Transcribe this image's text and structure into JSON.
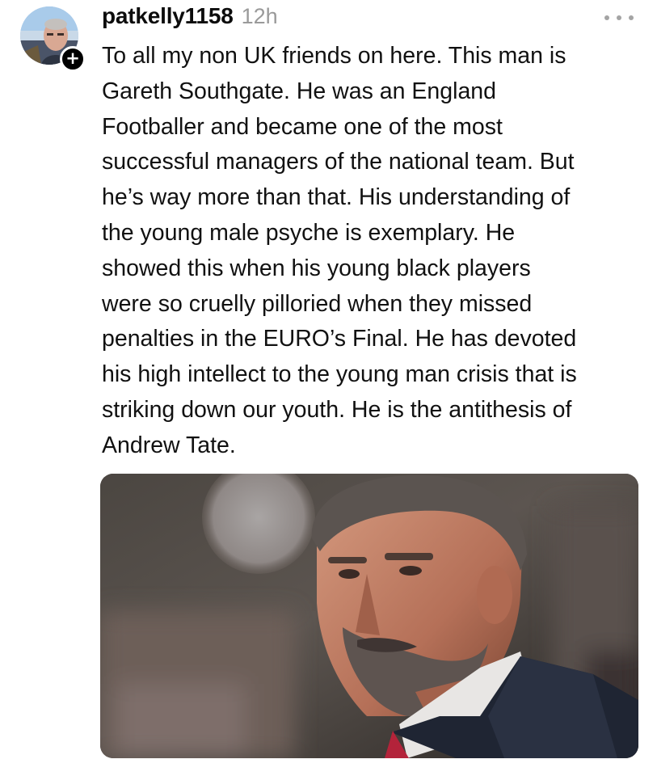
{
  "post": {
    "author": {
      "username": "patkelly1158",
      "avatar_icon": "profile-photo",
      "follow_icon": "plus-icon",
      "follow_symbol": "+"
    },
    "timestamp": "12h",
    "more_icon": "more-horizontal-icon",
    "text_lines": [
      "To all my non UK friends on here. This man is",
      "Gareth Southgate. He was an England",
      "Footballer and became one of the most",
      "successful managers of the national team. But",
      "he’s way more than that. His understanding of",
      "the young male psyche is exemplary. He",
      "showed this when his young black players",
      "were so cruelly pilloried when they missed",
      "penalties in the EURO’s Final. He has devoted",
      "his high intellect to the young man crisis that is",
      "striking down our youth. He is the antithesis of",
      "Andrew Tate."
    ],
    "image": {
      "description_icon": "photo-of-bearded-man"
    }
  },
  "colors": {
    "text": "#111111",
    "timestamp": "#9a9a9a",
    "badge": "#000000",
    "more_dots": "#a4a4a4"
  }
}
